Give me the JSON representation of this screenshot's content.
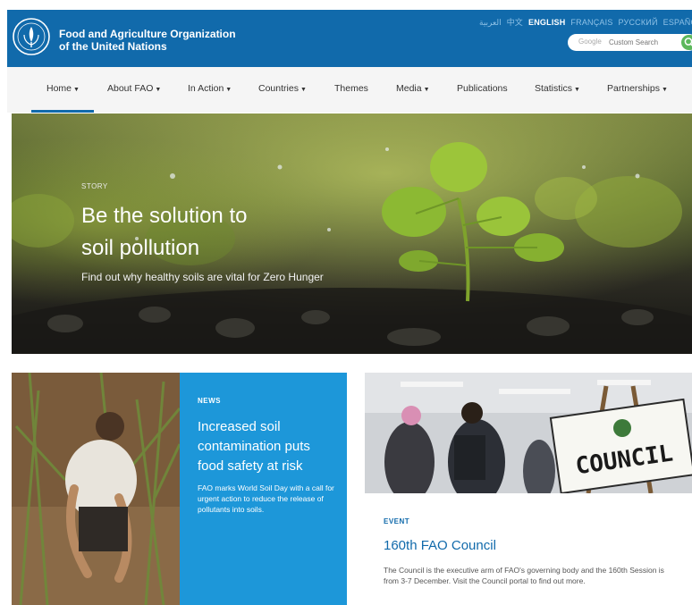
{
  "header": {
    "org_line1": "Food and Agriculture Organization",
    "org_line2": "of the United Nations",
    "logo_text": "FAO",
    "languages": [
      {
        "label": "العربية",
        "active": false
      },
      {
        "label": "中文",
        "active": false
      },
      {
        "label": "ENGLISH",
        "active": true
      },
      {
        "label": "FRANÇAIS",
        "active": false
      },
      {
        "label": "РУССКИЙ",
        "active": false
      },
      {
        "label": "ESPAÑOL",
        "active": false
      }
    ],
    "search_brand": "Google",
    "search_placeholder": "Custom Search"
  },
  "nav": {
    "items": [
      {
        "label": "Home",
        "caret": true,
        "active": true
      },
      {
        "label": "About FAO",
        "caret": true
      },
      {
        "label": "In Action",
        "caret": true
      },
      {
        "label": "Countries",
        "caret": true
      },
      {
        "label": "Themes",
        "caret": false
      },
      {
        "label": "Media",
        "caret": true
      },
      {
        "label": "Publications",
        "caret": false
      },
      {
        "label": "Statistics",
        "caret": true
      },
      {
        "label": "Partnerships",
        "caret": true
      }
    ]
  },
  "hero": {
    "kicker": "STORY",
    "title_line1": "Be the solution to",
    "title_line2": "soil pollution",
    "subtitle": "Find out why healthy soils are vital for Zero Hunger"
  },
  "news": {
    "kicker": "NEWS",
    "title": "Increased soil contamination puts food safety at risk",
    "description": "FAO marks World Soil Day with a call for urgent action to reduce the release of pollutants into soils."
  },
  "event": {
    "kicker": "EVENT",
    "title": "160th FAO Council",
    "description": "The Council is the executive arm of FAO's governing body and the 160th Session is from 3-7 December. Visit the Council portal to find out more.",
    "sign_text": "COUNCIL"
  },
  "colors": {
    "brand_blue": "#116aab",
    "news_blue": "#1d97d9",
    "search_green": "#5cb85c"
  }
}
